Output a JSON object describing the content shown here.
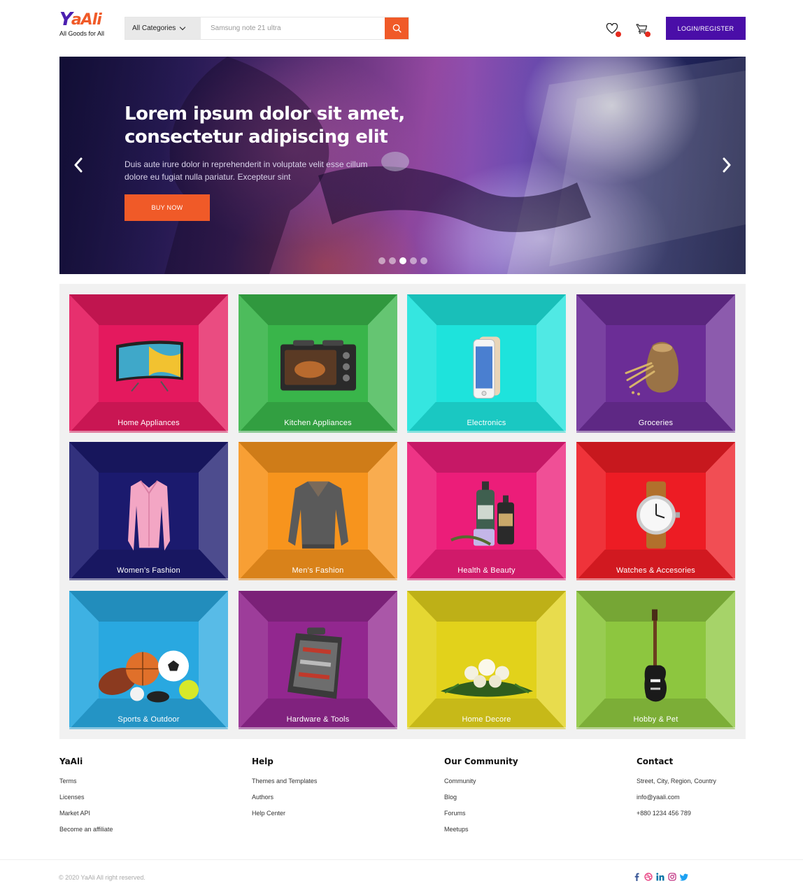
{
  "brand": {
    "logo_y": "Y",
    "logo_ali": "aAli",
    "tagline": "All Goods for All",
    "colors": {
      "primary": "#4a0ea8",
      "accent": "#f05a28",
      "badge": "#e52b1e"
    }
  },
  "header": {
    "category_select": "All Categories",
    "search_placeholder": "Samsung note 21 ultra",
    "search_icon": "search-icon",
    "wishlist_icon": "heart-icon",
    "cart_icon": "cart-icon",
    "login_label": "LOGIN/REGISTER"
  },
  "hero": {
    "title": "Lorem ipsum dolor sit amet, consectetur adipiscing elit",
    "subtitle": "Duis aute irure dolor in reprehenderit in voluptate velit esse cillum dolore eu fugiat nulla pariatur. Excepteur sint",
    "cta": "BUY NOW",
    "slide_count": 5,
    "active_slide": 3
  },
  "categories": [
    {
      "label": "Home Appliances",
      "color": "#e4195e",
      "icon": "tv-icon"
    },
    {
      "label": "Kitchen Appliances",
      "color": "#39b54a",
      "icon": "oven-icon"
    },
    {
      "label": "Electronics",
      "color": "#1ee3dc",
      "icon": "phone-icon"
    },
    {
      "label": "Groceries",
      "color": "#6b2d96",
      "icon": "grain-sack-icon"
    },
    {
      "label": "Women’s Fashion",
      "color": "#1b1a6e",
      "icon": "blouse-icon"
    },
    {
      "label": "Men’s Fashion",
      "color": "#f7941d",
      "icon": "sweater-icon"
    },
    {
      "label": "Health & Beauty",
      "color": "#ec1d79",
      "icon": "bottles-icon"
    },
    {
      "label": "Watches & Accesories",
      "color": "#ed1c24",
      "icon": "watch-icon"
    },
    {
      "label": "Sports & Outdoor",
      "color": "#29a8e0",
      "icon": "balls-icon"
    },
    {
      "label": "Hardware & Tools",
      "color": "#92278f",
      "icon": "toolbox-icon"
    },
    {
      "label": "Home Decore",
      "color": "#e2d21b",
      "icon": "flowers-icon"
    },
    {
      "label": "Hobby & Pet",
      "color": "#8dc63f",
      "icon": "guitar-icon"
    }
  ],
  "footer": {
    "columns": [
      {
        "title": "YaAli",
        "links": [
          "Terms",
          "Licenses",
          "Market API",
          "Become an affiliate"
        ]
      },
      {
        "title": "Help",
        "links": [
          "Themes and Templates",
          "Authors",
          "Help Center"
        ]
      },
      {
        "title": "Our Community",
        "links": [
          "Community",
          "Blog",
          "Forums",
          "Meetups"
        ]
      },
      {
        "title": "Contact",
        "links": [
          "Street, City, Region, Country",
          "info@yaali.com",
          "+880 1234 456 789"
        ]
      }
    ],
    "copyright": "© 2020 YaAli All right reserved.",
    "social": [
      "facebook-icon",
      "dribbble-icon",
      "linkedin-icon",
      "instagram-icon",
      "twitter-icon"
    ]
  }
}
